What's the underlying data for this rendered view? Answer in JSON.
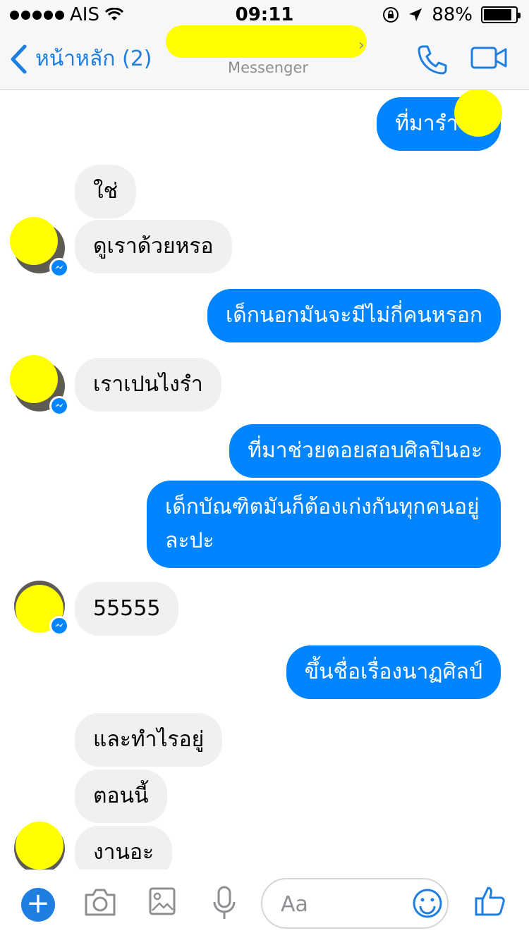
{
  "status_bar": {
    "carrier": "AIS",
    "time": "09:11",
    "battery_percent": "88%",
    "battery_level": 0.88
  },
  "nav": {
    "back_label": "หน้าหลัก (2)",
    "subtitle": "Messenger",
    "call_icon": "phone-icon",
    "video_icon": "video-camera-icon"
  },
  "messages": [
    {
      "side": "out",
      "text": "ที่มารำให้"
    },
    {
      "side": "in",
      "text": "ใช่"
    },
    {
      "side": "in",
      "text": "ดูเราด้วยหรอ"
    },
    {
      "side": "out",
      "text": "เด็กนอกมันจะมีไม่กี่คนหรอก"
    },
    {
      "side": "in",
      "text": "เราเปนไงรำ"
    },
    {
      "side": "out",
      "text": "ที่มาช่วยตอยสอบศิลปินอะ"
    },
    {
      "side": "out",
      "text": "เด็กบัณฑิตมันก็ต้องเก่งกันทุกคนอยู่ละปะ"
    },
    {
      "side": "in",
      "text": "55555"
    },
    {
      "side": "out",
      "text": "ขึ้นชื่อเรื่องนาฏศิลป์"
    },
    {
      "side": "in",
      "text": "และทำไรอยู่"
    },
    {
      "side": "in",
      "text": "ตอนนี้"
    },
    {
      "side": "in",
      "text": "งานอะ"
    }
  ],
  "composer": {
    "placeholder": "Aa",
    "icons": [
      "plus-icon",
      "camera-icon",
      "gallery-icon",
      "microphone-icon",
      "emoji-icon",
      "thumbs-up-icon"
    ]
  },
  "colors": {
    "accent": "#0084ff",
    "nav_blue": "#1e7fe0",
    "incoming_bubble": "#f1f0f0",
    "redaction": "#ffff00"
  }
}
